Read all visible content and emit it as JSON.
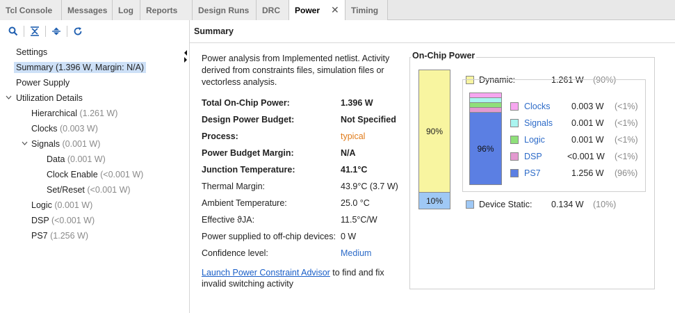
{
  "tabs": [
    {
      "label": "Tcl Console"
    },
    {
      "label": "Messages"
    },
    {
      "label": "Log"
    },
    {
      "label": "Reports"
    },
    {
      "label": "Design Runs"
    },
    {
      "label": "DRC"
    },
    {
      "label": "Power",
      "close": "✕"
    },
    {
      "label": "Timing"
    }
  ],
  "toolbar": {
    "icons": [
      "search-icon",
      "collapse-all-icon",
      "expand-all-icon",
      "refresh-icon"
    ]
  },
  "tree": [
    {
      "label": "Settings"
    },
    {
      "label": "Summary (1.396 W, Margin: N/A)"
    },
    {
      "label": "Power Supply"
    },
    {
      "label": "Utilization Details"
    },
    {
      "label": "Hierarchical",
      "value": "(1.261 W)"
    },
    {
      "label": "Clocks",
      "value": "(0.003 W)"
    },
    {
      "label": "Signals",
      "value": "(0.001 W)"
    },
    {
      "label": "Data",
      "value": "(0.001 W)"
    },
    {
      "label": "Clock Enable",
      "value": "(<0.001 W)"
    },
    {
      "label": "Set/Reset",
      "value": "(<0.001 W)"
    },
    {
      "label": "Logic",
      "value": "(0.001 W)"
    },
    {
      "label": "DSP",
      "value": "(<0.001 W)"
    },
    {
      "label": "PS7",
      "value": "(1.256 W)"
    }
  ],
  "summary": {
    "title": "Summary",
    "intro": "Power analysis from Implemented netlist. Activity derived from constraints files, simulation files or vectorless analysis.",
    "rows": [
      {
        "key": "Total On-Chip Power:",
        "value": "1.396 W"
      },
      {
        "key": "Design Power Budget:",
        "value": "Not Specified"
      },
      {
        "key": "Process:",
        "value": "typical"
      },
      {
        "key": "Power Budget Margin:",
        "value": "N/A"
      },
      {
        "key": "Junction Temperature:",
        "value": "41.1°C"
      },
      {
        "key": "Thermal Margin:",
        "value": "43.9°C (3.7 W)"
      },
      {
        "key": "Ambient Temperature:",
        "value": "25.0 °C"
      },
      {
        "key": "Effective ϑJA:",
        "value": "11.5°C/W"
      },
      {
        "key": "Power supplied to off-chip devices:",
        "value": "0 W"
      },
      {
        "key": "Confidence level:",
        "value": "Medium"
      }
    ],
    "link_text": "Launch Power Constraint Advisor",
    "link_suffix": " to find and fix invalid switching activity"
  },
  "on_chip": {
    "title": "On-Chip Power",
    "dynamic_pct": "90%",
    "static_pct": "10%",
    "dynamic_label": "Dynamic:",
    "dynamic_value": "1.261 W",
    "dynamic_share": "(90%)",
    "static_label": "Device Static:",
    "static_value": "0.134 W",
    "static_share": "(10%)",
    "ps7_bar_pct": "96%",
    "colors": {
      "dynamic": "#f8f5a0",
      "static": "#9fc8f5",
      "clocks": "#f7a6f0",
      "signals": "#aaf5f0",
      "logic": "#8fe07a",
      "dsp": "#e39ad0",
      "ps7": "#5b7fe3"
    },
    "breakdown": [
      {
        "name": "Clocks",
        "value": "0.003 W",
        "pct": "(<1%)"
      },
      {
        "name": "Signals",
        "value": "0.001 W",
        "pct": "(<1%)"
      },
      {
        "name": "Logic",
        "value": "0.001 W",
        "pct": "(<1%)"
      },
      {
        "name": "DSP",
        "value": "<0.001 W",
        "pct": "(<1%)"
      },
      {
        "name": "PS7",
        "value": "1.256 W",
        "pct": "(96%)"
      }
    ]
  }
}
